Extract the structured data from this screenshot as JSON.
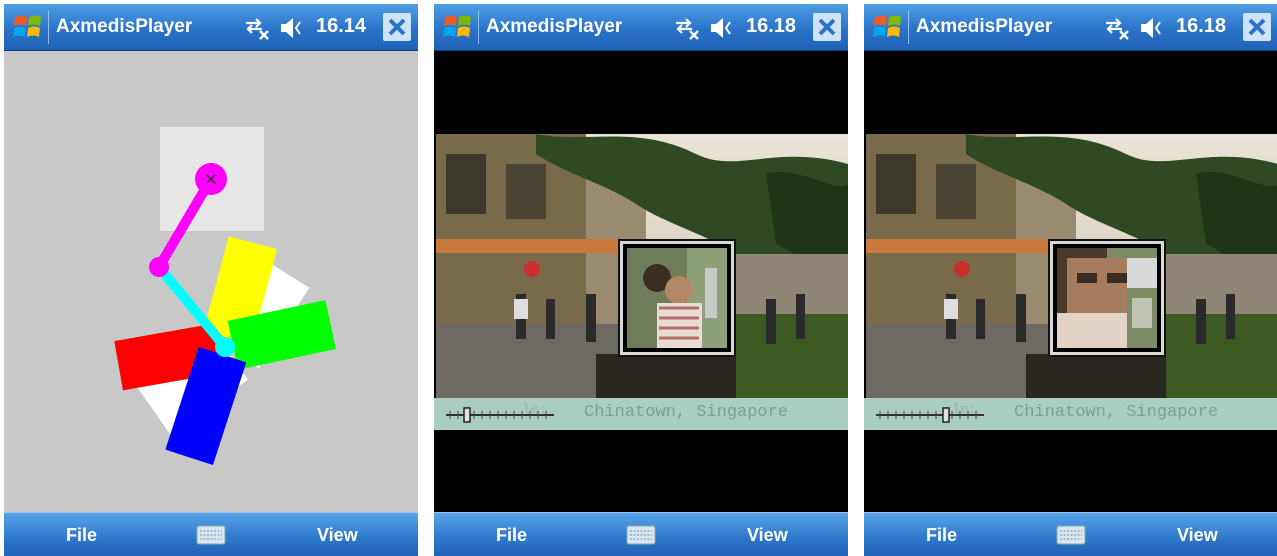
{
  "screens": [
    {
      "title": "AxmedisPlayer",
      "time": "16.14",
      "menu_left": "File",
      "menu_right": "View"
    },
    {
      "title": "AxmedisPlayer",
      "time": "16.18",
      "menu_left": "File",
      "menu_right": "View",
      "caption": "Chinatown, Singapore",
      "slider_position": 0.2
    },
    {
      "title": "AxmedisPlayer",
      "time": "16.18",
      "menu_left": "File",
      "menu_right": "View",
      "caption": "Chinatown, Singapore",
      "slider_position": 0.65
    }
  ],
  "icons": {
    "start": "windows-start-icon",
    "connectivity": "connectivity-icon",
    "volume": "volume-icon",
    "close": "close-icon",
    "keyboard": "keyboard-icon"
  },
  "colors": {
    "titlebar": "#2a73c9",
    "menubar": "#2f79cc",
    "canvas": "#c8c8c8",
    "caption_bar": "#a9cec1"
  }
}
